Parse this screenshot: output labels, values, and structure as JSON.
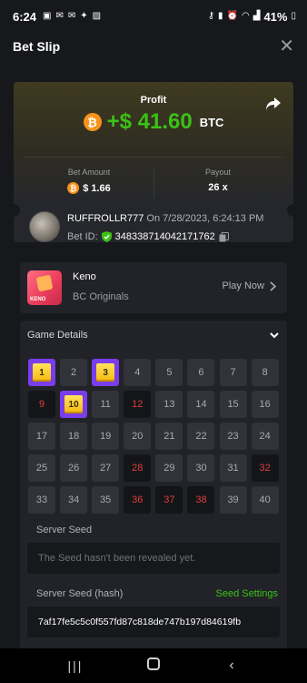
{
  "status_bar": {
    "time": "6:24",
    "battery": "41%"
  },
  "header": {
    "title": "Bet Slip"
  },
  "ticket": {
    "profit_label": "Profit",
    "profit_amount": "+$ 41.60",
    "profit_currency": "BTC",
    "bet_amount_label": "Bet Amount",
    "bet_amount_value": "$ 1.66",
    "payout_label": "Payout",
    "payout_value": "26 x",
    "coin_symbol": "₿"
  },
  "user": {
    "username": "RUFFROLLR777",
    "date_text": "On 7/28/2023, 6:24:13 PM",
    "bet_id_label": "Bet ID:",
    "bet_id_value": "348338714042171762"
  },
  "game": {
    "name": "Keno",
    "provider": "BC Originals",
    "play_label": "Play Now",
    "thumb_word": "KENO"
  },
  "details": {
    "title": "Game Details",
    "server_seed_label": "Server Seed",
    "server_seed_placeholder": "The Seed hasn't been revealed yet.",
    "server_seed_hash_label": "Server Seed (hash)",
    "seed_settings_label": "Seed Settings",
    "server_seed_hash_value": "7af17fe5c5c0f557fd87c818de747b197d84619fb"
  },
  "keno": {
    "numbers": [
      1,
      2,
      3,
      4,
      5,
      6,
      7,
      8,
      9,
      10,
      11,
      12,
      13,
      14,
      15,
      16,
      17,
      18,
      19,
      20,
      21,
      22,
      23,
      24,
      25,
      26,
      27,
      28,
      29,
      30,
      31,
      32,
      33,
      34,
      35,
      36,
      37,
      38,
      39,
      40
    ],
    "hits": [
      1,
      3,
      10
    ],
    "misses": [
      9,
      12,
      28,
      32,
      36,
      37,
      38
    ]
  },
  "colors": {
    "profit_green": "#3bc117",
    "hit_purple": "#7a3dea",
    "miss_red": "#e23d3d",
    "btc_orange": "#f7931a"
  }
}
